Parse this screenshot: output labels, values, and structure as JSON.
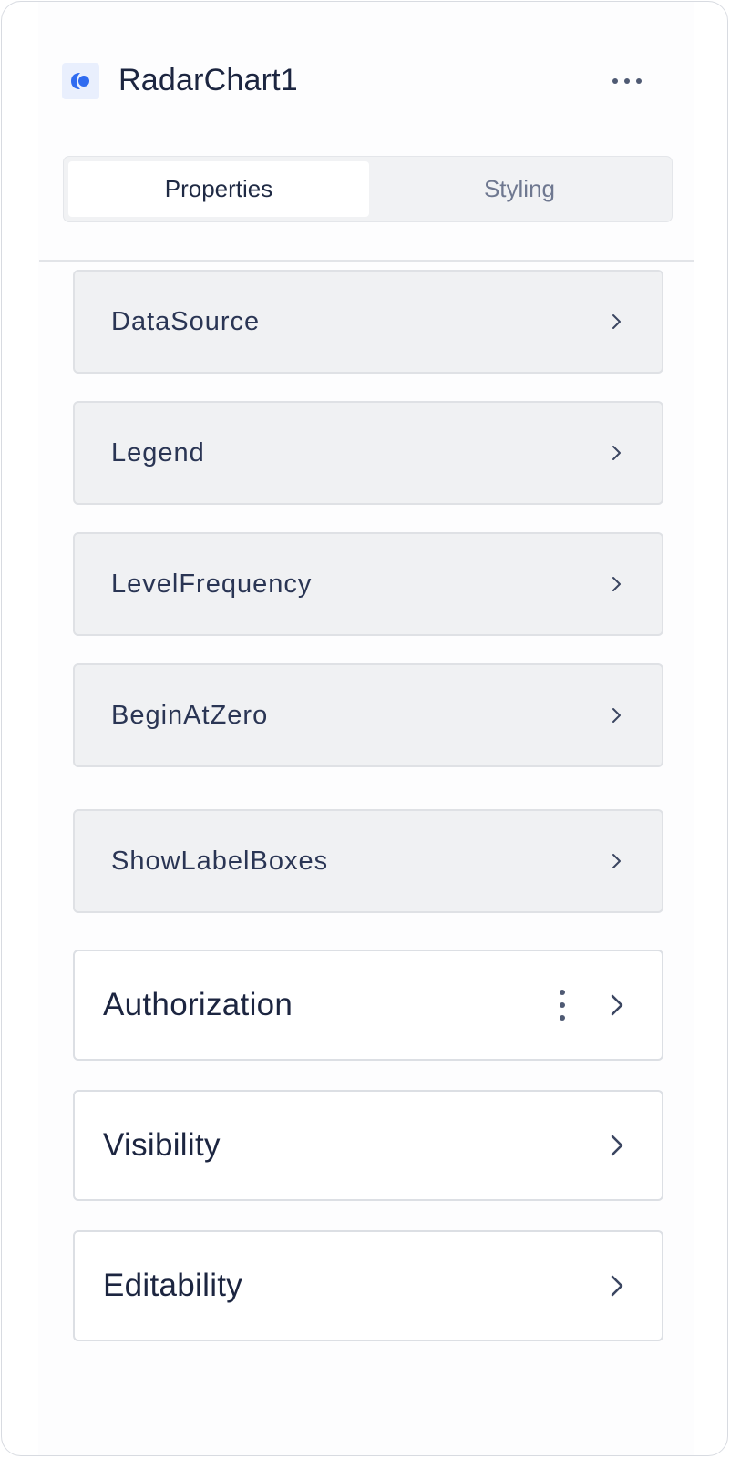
{
  "header": {
    "title": "RadarChart1",
    "app_icon": "radar-chart-icon",
    "more_icon": "more-horizontal-icon"
  },
  "tabs": [
    {
      "label": "Properties",
      "active": true
    },
    {
      "label": "Styling",
      "active": false
    }
  ],
  "property_groups": [
    {
      "label": "DataSource",
      "icon": "chevron-right-icon"
    },
    {
      "label": "Legend",
      "icon": "chevron-right-icon"
    },
    {
      "label": "LevelFrequency",
      "icon": "chevron-right-icon"
    },
    {
      "label": "BeginAtZero",
      "icon": "chevron-right-icon"
    },
    {
      "label": "ShowLabelBoxes",
      "icon": "chevron-right-icon"
    }
  ],
  "sections": [
    {
      "label": "Authorization",
      "has_menu": true,
      "icon": "chevron-right-icon"
    },
    {
      "label": "Visibility",
      "has_menu": false,
      "icon": "chevron-right-icon"
    },
    {
      "label": "Editability",
      "has_menu": false,
      "icon": "chevron-right-icon"
    }
  ],
  "colors": {
    "accent": "#2f6bf0",
    "text": "#1f2a44",
    "muted": "#6f7890",
    "row_bg": "#f0f1f3"
  }
}
